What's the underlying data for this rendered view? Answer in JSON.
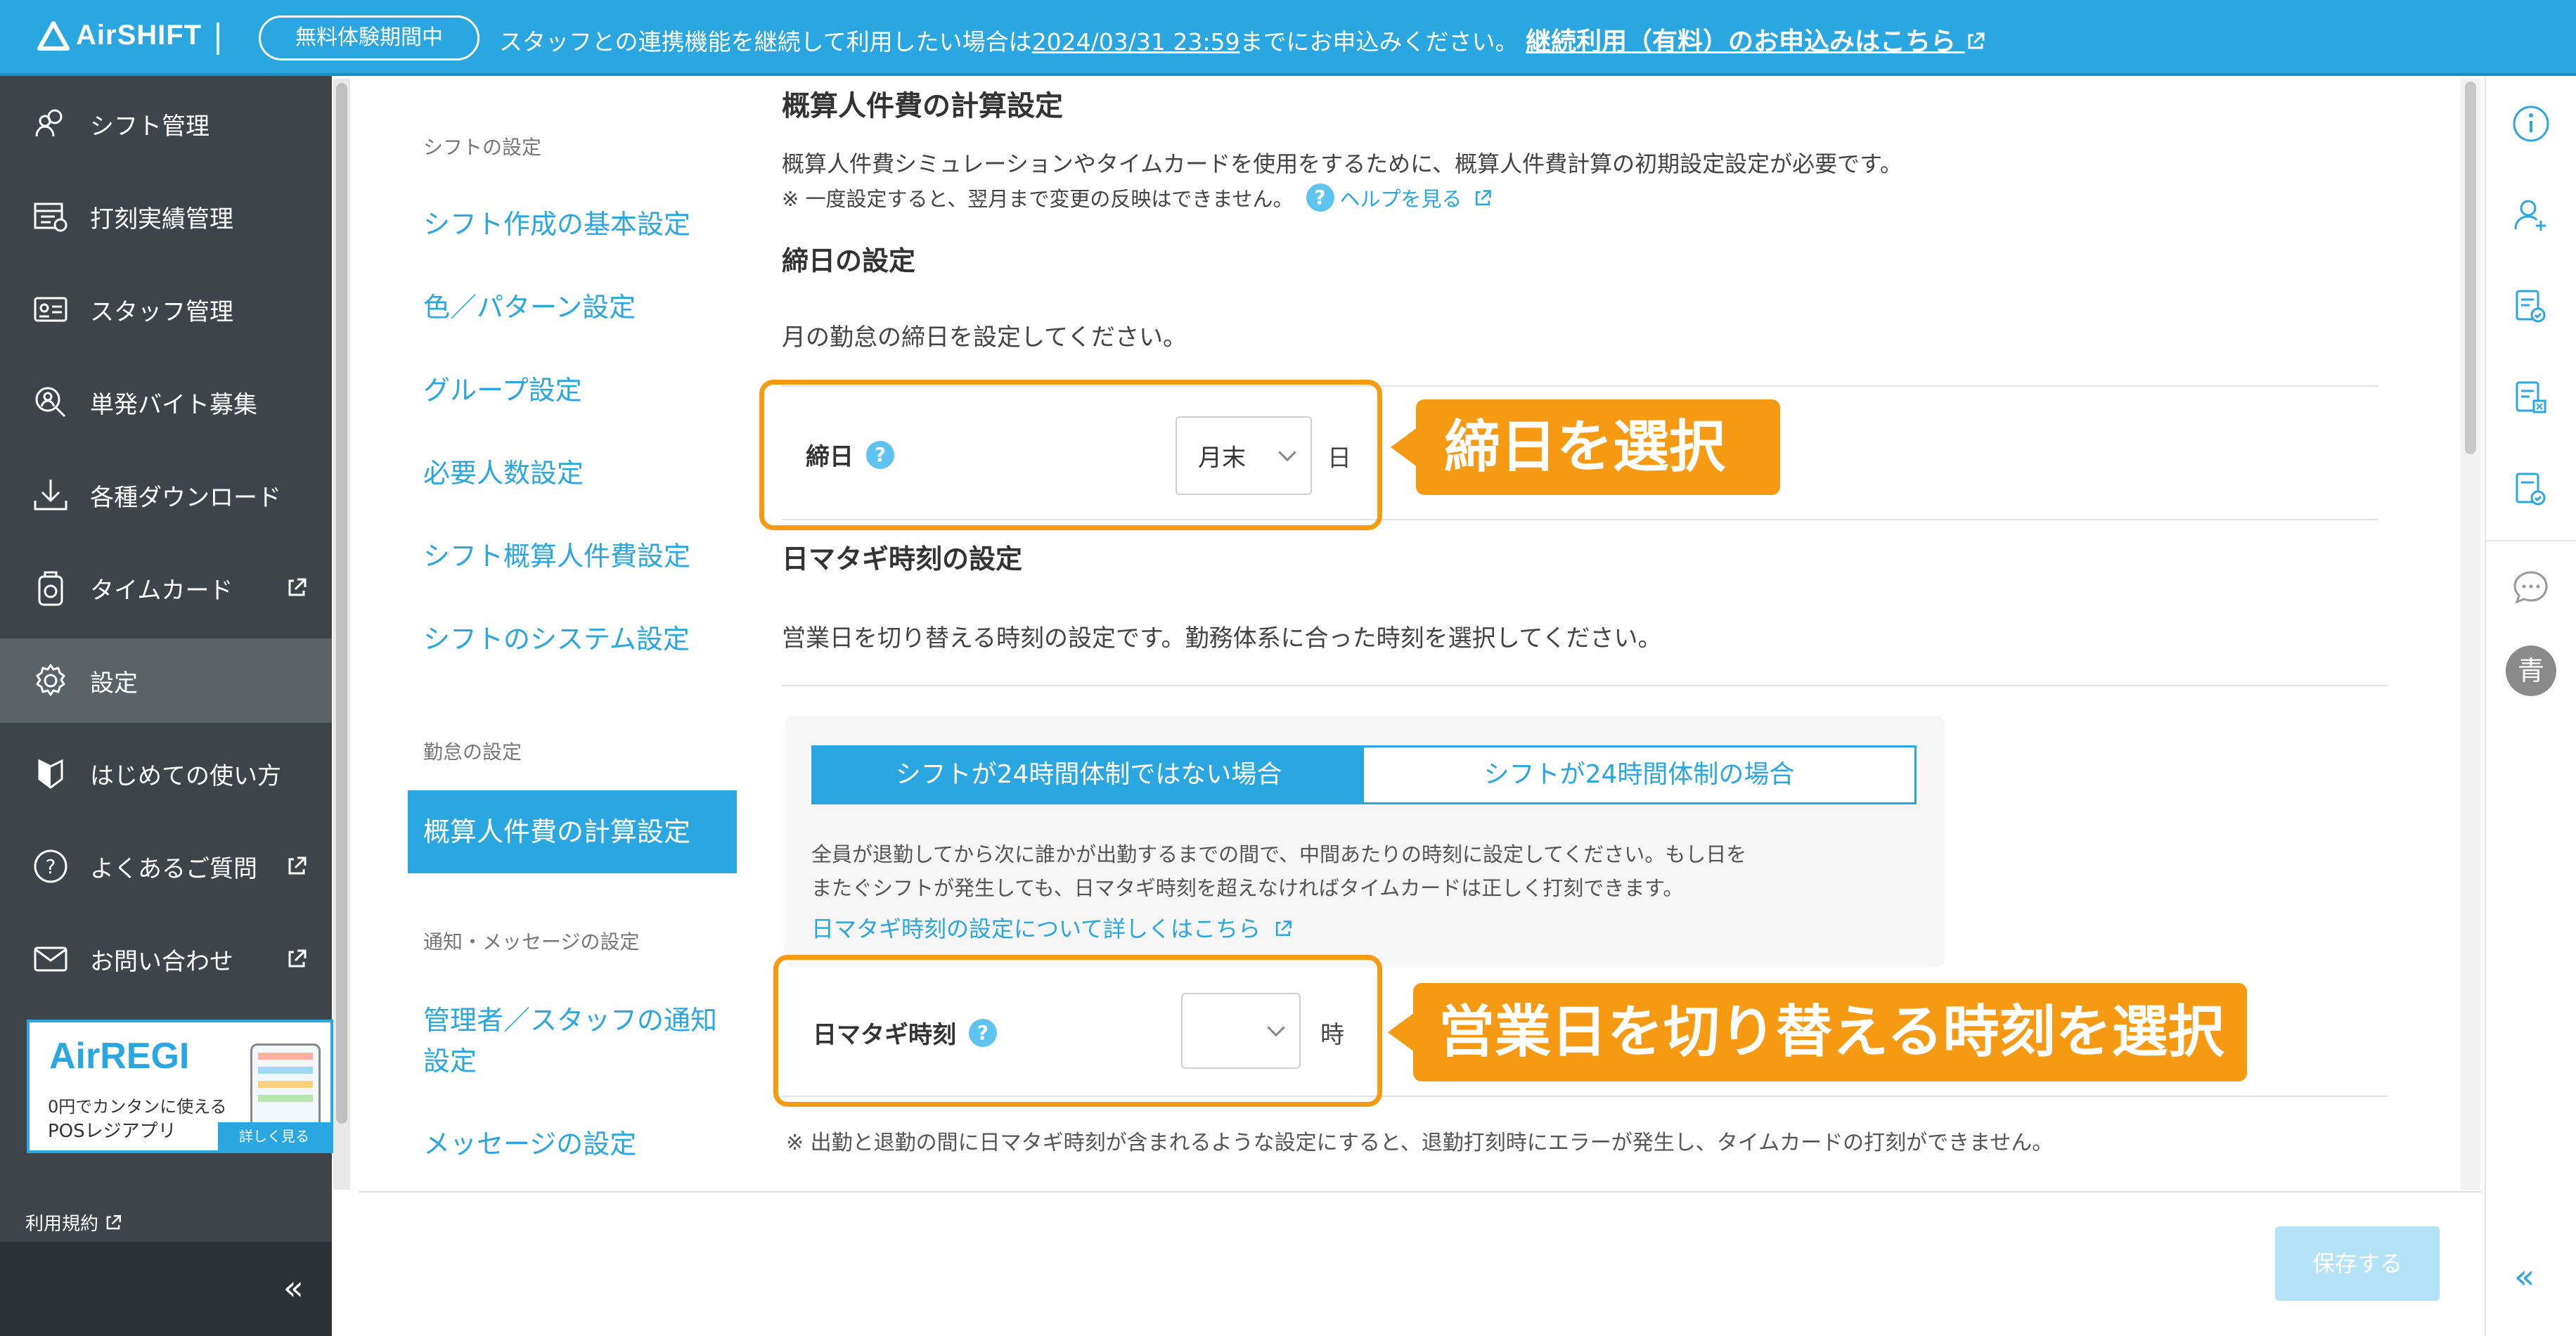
{
  "header": {
    "logo": "AirSHIFT",
    "trial_badge": "無料体験期間中",
    "notice_prefix": "スタッフとの連携機能を継続して利用したい場合は",
    "notice_date": "2024/03/31 23:59",
    "notice_middle": "までにお申込みください。",
    "notice_link": "継続利用（有料）のお申込みはこちら"
  },
  "sidebar": {
    "items": [
      {
        "label": "シフト管理",
        "icon": "shift-management-icon"
      },
      {
        "label": "打刻実績管理",
        "icon": "clock-record-icon"
      },
      {
        "label": "スタッフ管理",
        "icon": "staff-card-icon"
      },
      {
        "label": "単発バイト募集",
        "icon": "recruit-search-icon"
      },
      {
        "label": "各種ダウンロード",
        "icon": "download-icon"
      },
      {
        "label": "タイムカード",
        "icon": "timecard-icon"
      },
      {
        "label": "設定",
        "icon": "gear-icon"
      },
      {
        "label": "はじめての使い方",
        "icon": "beginner-mark-icon"
      },
      {
        "label": "よくあるご質問",
        "icon": "question-icon"
      },
      {
        "label": "お問い合わせ",
        "icon": "mail-icon"
      }
    ],
    "ad": {
      "logo": "AirREGI",
      "line1": "0円でカンタンに使える",
      "line2": "POSレジアプリ",
      "more": "詳しく見る"
    },
    "terms": "利用規約",
    "collapse": "«"
  },
  "submenu": {
    "heading_shift": "シフトの設定",
    "shift_items": [
      "シフト作成の基本設定",
      "色／パターン設定",
      "グループ設定",
      "必要人数設定",
      "シフト概算人件費設定",
      "シフトのシステム設定"
    ],
    "heading_attendance": "勤怠の設定",
    "attendance_items": [
      "概算人件費の計算設定"
    ],
    "heading_notice": "通知・メッセージの設定",
    "notice_item_1": "管理者／スタッフの通知設定",
    "notice_item_2": "メッセージの設定"
  },
  "main": {
    "title": "概算人件費の計算設定",
    "desc1": "概算人件費シミュレーションやタイムカードを使用をするために、概算人件費計算の初期設定設定が必要です。",
    "desc2": "※ 一度設定すると、翌月まで変更の反映はできません。",
    "help_icon": "?",
    "help_link": "ヘルプを見る",
    "closing": {
      "heading": "締日の設定",
      "text": "月の勤怠の締日を設定してください。",
      "label": "締日",
      "value": "月末",
      "unit": "日"
    },
    "daybreak": {
      "heading": "日マタギ時刻の設定",
      "text": "営業日を切り替える時刻の設定です。勤務体系に合った時刻を選択してください。",
      "tab_not_24h": "シフトが24時間体制ではない場合",
      "tab_24h": "シフトが24時間体制の場合",
      "panel_line1": "全員が退勤してから次に誰かが出勤するまでの間で、中間あたりの時刻に設定してください。もし日を",
      "panel_line2": "またぐシフトが発生しても、日マタギ時刻を超えなければタイムカードは正しく打刻できます。",
      "panel_link": "日マタギ時刻の設定について詳しくはこちら",
      "label": "日マタギ時刻",
      "value": "",
      "unit": "時",
      "note": "※ 出勤と退勤の間に日マタギ時刻が含まれるような設定にすると、退勤打刻時にエラーが発生し、タイムカードの打刻ができません。"
    },
    "save": "保存する"
  },
  "callouts": {
    "closing": "締日を選択",
    "daybreak": "営業日を切り替える時刻を選択"
  },
  "rightrail": {
    "avatar": "青",
    "collapse": "«"
  },
  "colors": {
    "brand": "#2aa7e0",
    "highlight": "#f59a12",
    "sidebar": "#3e4449"
  }
}
